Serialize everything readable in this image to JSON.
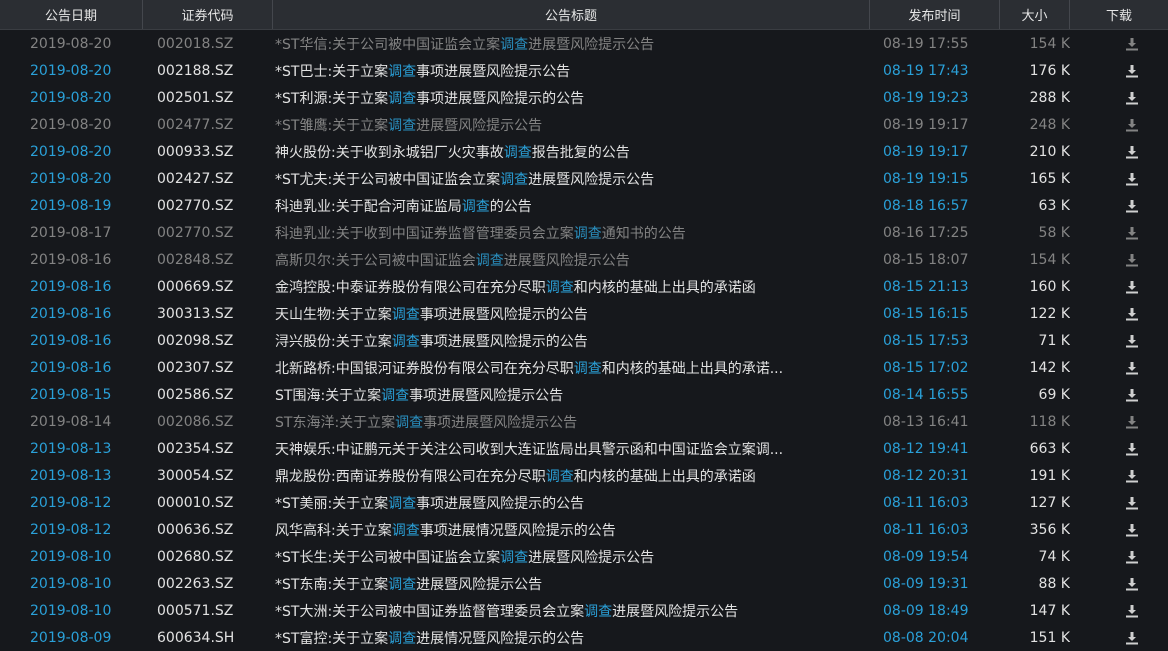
{
  "headers": {
    "date": "公告日期",
    "code": "证券代码",
    "title": "公告标题",
    "time": "发布时间",
    "size": "大小",
    "download": "下载"
  },
  "keyword": "调查",
  "colors": {
    "link_blue": "#2aa0d8",
    "read_gray": "#838383",
    "background": "#16181c",
    "header_bg": "#2b2e33"
  },
  "download_icon": "download-icon",
  "rows": [
    {
      "date": "2019-08-20",
      "code": "002018.SZ",
      "title": "*ST华信:关于公司被中国证监会立案调查进展暨风险提示公告",
      "time": "08-19 17:55",
      "size": "154 K",
      "read": true
    },
    {
      "date": "2019-08-20",
      "code": "002188.SZ",
      "title": "*ST巴士:关于立案调查事项进展暨风险提示公告",
      "time": "08-19 17:43",
      "size": "176 K",
      "read": false
    },
    {
      "date": "2019-08-20",
      "code": "002501.SZ",
      "title": "*ST利源:关于立案调查事项进展暨风险提示的公告",
      "time": "08-19 19:23",
      "size": "288 K",
      "read": false
    },
    {
      "date": "2019-08-20",
      "code": "002477.SZ",
      "title": "*ST雏鹰:关于立案调查进展暨风险提示公告",
      "time": "08-19 19:17",
      "size": "248 K",
      "read": true
    },
    {
      "date": "2019-08-20",
      "code": "000933.SZ",
      "title": "神火股份:关于收到永城铝厂火灾事故调查报告批复的公告",
      "time": "08-19 19:17",
      "size": "210 K",
      "read": false
    },
    {
      "date": "2019-08-20",
      "code": "002427.SZ",
      "title": "*ST尤夫:关于公司被中国证监会立案调查进展暨风险提示公告",
      "time": "08-19 19:15",
      "size": "165 K",
      "read": false
    },
    {
      "date": "2019-08-19",
      "code": "002770.SZ",
      "title": "科迪乳业:关于配合河南证监局调查的公告",
      "time": "08-18 16:57",
      "size": "63 K",
      "read": false
    },
    {
      "date": "2019-08-17",
      "code": "002770.SZ",
      "title": "科迪乳业:关于收到中国证券监督管理委员会立案调查通知书的公告",
      "time": "08-16 17:25",
      "size": "58 K",
      "read": true
    },
    {
      "date": "2019-08-16",
      "code": "002848.SZ",
      "title": "高斯贝尔:关于公司被中国证监会调查进展暨风险提示公告",
      "time": "08-15 18:07",
      "size": "154 K",
      "read": true
    },
    {
      "date": "2019-08-16",
      "code": "000669.SZ",
      "title": "金鸿控股:中泰证券股份有限公司在充分尽职调查和内核的基础上出具的承诺函",
      "time": "08-15 21:13",
      "size": "160 K",
      "read": false
    },
    {
      "date": "2019-08-16",
      "code": "300313.SZ",
      "title": "天山生物:关于立案调查事项进展暨风险提示的公告",
      "time": "08-15 16:15",
      "size": "122 K",
      "read": false
    },
    {
      "date": "2019-08-16",
      "code": "002098.SZ",
      "title": "浔兴股份:关于立案调查事项进展暨风险提示的公告",
      "time": "08-15 17:53",
      "size": "71 K",
      "read": false
    },
    {
      "date": "2019-08-16",
      "code": "002307.SZ",
      "title": "北新路桥:中国银河证券股份有限公司在充分尽职调查和内核的基础上出具的承诺...",
      "time": "08-15 17:02",
      "size": "142 K",
      "read": false
    },
    {
      "date": "2019-08-15",
      "code": "002586.SZ",
      "title": "ST围海:关于立案调查事项进展暨风险提示公告",
      "time": "08-14 16:55",
      "size": "69 K",
      "read": false
    },
    {
      "date": "2019-08-14",
      "code": "002086.SZ",
      "title": "ST东海洋:关于立案调查事项进展暨风险提示公告",
      "time": "08-13 16:41",
      "size": "118 K",
      "read": true
    },
    {
      "date": "2019-08-13",
      "code": "002354.SZ",
      "title": "天神娱乐:中证鹏元关于关注公司收到大连证监局出具警示函和中国证监会立案调...",
      "time": "08-12 19:41",
      "size": "663 K",
      "read": false
    },
    {
      "date": "2019-08-13",
      "code": "300054.SZ",
      "title": "鼎龙股份:西南证券股份有限公司在充分尽职调查和内核的基础上出具的承诺函",
      "time": "08-12 20:31",
      "size": "191 K",
      "read": false
    },
    {
      "date": "2019-08-12",
      "code": "000010.SZ",
      "title": "*ST美丽:关于立案调查事项进展暨风险提示的公告",
      "time": "08-11 16:03",
      "size": "127 K",
      "read": false
    },
    {
      "date": "2019-08-12",
      "code": "000636.SZ",
      "title": "风华高科:关于立案调查事项进展情况暨风险提示的公告",
      "time": "08-11 16:03",
      "size": "356 K",
      "read": false
    },
    {
      "date": "2019-08-10",
      "code": "002680.SZ",
      "title": "*ST长生:关于公司被中国证监会立案调查进展暨风险提示公告",
      "time": "08-09 19:54",
      "size": "74 K",
      "read": false
    },
    {
      "date": "2019-08-10",
      "code": "002263.SZ",
      "title": "*ST东南:关于立案调查进展暨风险提示公告",
      "time": "08-09 19:31",
      "size": "88 K",
      "read": false
    },
    {
      "date": "2019-08-10",
      "code": "000571.SZ",
      "title": "*ST大洲:关于公司被中国证券监督管理委员会立案调查进展暨风险提示公告",
      "time": "08-09 18:49",
      "size": "147 K",
      "read": false
    },
    {
      "date": "2019-08-09",
      "code": "600634.SH",
      "title": "*ST富控:关于立案调查进展情况暨风险提示的公告",
      "time": "08-08 20:04",
      "size": "151 K",
      "read": false
    }
  ]
}
